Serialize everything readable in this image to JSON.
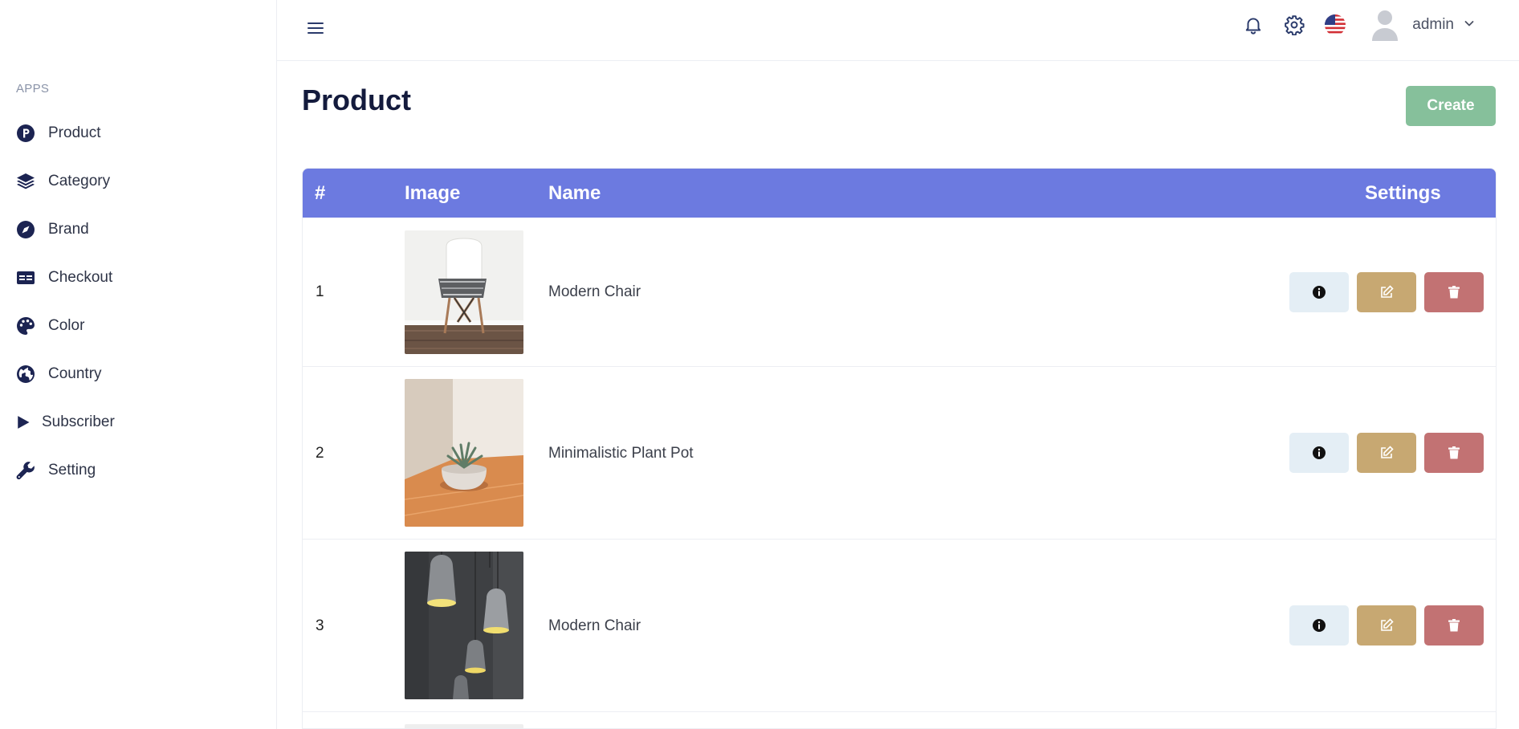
{
  "sidebar": {
    "section_label": "APPS",
    "items": [
      {
        "label": "Product",
        "icon": "product-p-icon"
      },
      {
        "label": "Category",
        "icon": "layers-icon"
      },
      {
        "label": "Brand",
        "icon": "compass-icon"
      },
      {
        "label": "Checkout",
        "icon": "id-card-icon"
      },
      {
        "label": "Color",
        "icon": "palette-icon"
      },
      {
        "label": "Country",
        "icon": "globe-icon"
      },
      {
        "label": "Subscriber",
        "icon": "play-icon"
      },
      {
        "label": "Setting",
        "icon": "wrench-icon"
      }
    ]
  },
  "header": {
    "username": "admin",
    "icons": [
      "menu-icon",
      "bell-icon",
      "gear-icon",
      "us-flag-icon",
      "user-avatar-icon",
      "chevron-down-icon"
    ]
  },
  "main": {
    "title": "Product",
    "create_label": "Create",
    "table": {
      "columns": [
        "#",
        "Image",
        "Name",
        "Settings"
      ],
      "rows": [
        {
          "num": "1",
          "name": "Modern Chair",
          "image": "white-chair-photo"
        },
        {
          "num": "2",
          "name": "Minimalistic Plant Pot",
          "image": "plant-pot-photo"
        },
        {
          "num": "3",
          "name": "Modern Chair",
          "image": "pendant-lamps-photo"
        }
      ]
    }
  },
  "colors": {
    "table_header": "#6c7ae0",
    "create_button": "#86c09b",
    "info_button": "#e4eef5",
    "edit_button": "#c7a872",
    "delete_button": "#c27273",
    "title": "#141b3d"
  }
}
